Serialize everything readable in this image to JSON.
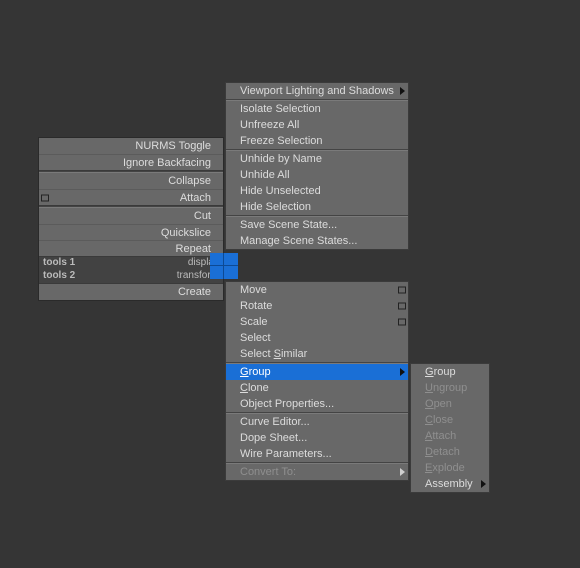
{
  "left": {
    "rows1": [
      "NURMS Toggle",
      "Ignore Backfacing"
    ],
    "rows2": [
      "Collapse",
      "Attach"
    ],
    "rows3": [
      "Cut",
      "Quickslice",
      "Repeat"
    ],
    "title1_left": "tools 1",
    "title1_right": "display",
    "title2_left": "tools 2",
    "title2_right": "transform",
    "create": "Create"
  },
  "mid": {
    "g1": [
      "Viewport Lighting and Shadows"
    ],
    "g2": [
      "Isolate Selection",
      "Unfreeze All",
      "Freeze Selection"
    ],
    "g3": [
      "Unhide by Name",
      "Unhide All",
      "Hide Unselected",
      "Hide Selection"
    ],
    "g4": [
      "Save Scene State...",
      "Manage Scene States..."
    ],
    "g5": [
      "Move",
      "Rotate",
      "Scale",
      "Select"
    ],
    "select_similar_pre": "Select ",
    "select_similar_u": "S",
    "select_similar_post": "imilar",
    "group_u": "G",
    "group_post": "roup",
    "clone_u": "C",
    "clone_post": "lone",
    "g6b": "Object Properties...",
    "g7": [
      "Curve Editor...",
      "Dope Sheet...",
      "Wire Parameters..."
    ],
    "convert": "Convert To:"
  },
  "right": {
    "group_u": "G",
    "group_post": "roup",
    "ungroup_u": "U",
    "ungroup_post": "ngroup",
    "open_u": "O",
    "open_post": "pen",
    "close_u": "C",
    "close_post": "lose",
    "attach_u": "A",
    "attach_post": "ttach",
    "detach_u": "D",
    "detach_post": "etach",
    "explode_u": "E",
    "explode_post": "xplode",
    "assembly": "Assembly"
  }
}
